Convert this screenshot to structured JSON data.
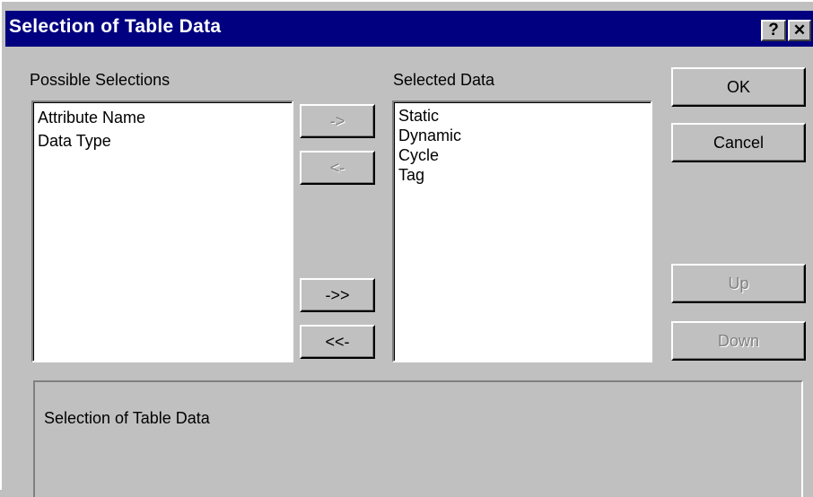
{
  "window": {
    "title": "Selection of Table Data",
    "help_label": "?",
    "close_label": "✕"
  },
  "possible": {
    "label": "Possible Selections",
    "items": [
      "Attribute Name",
      "Data Type"
    ]
  },
  "selected": {
    "label": "Selected Data",
    "items": [
      "Static",
      "Dynamic",
      "Cycle",
      "Tag"
    ]
  },
  "transfer_buttons": {
    "add": "->",
    "remove": "<-",
    "add_all": "->>",
    "remove_all": "<<-"
  },
  "action_buttons": {
    "ok": "OK",
    "cancel": "Cancel",
    "up": "Up",
    "down": "Down"
  },
  "description": {
    "text": "Selection of Table Data"
  }
}
